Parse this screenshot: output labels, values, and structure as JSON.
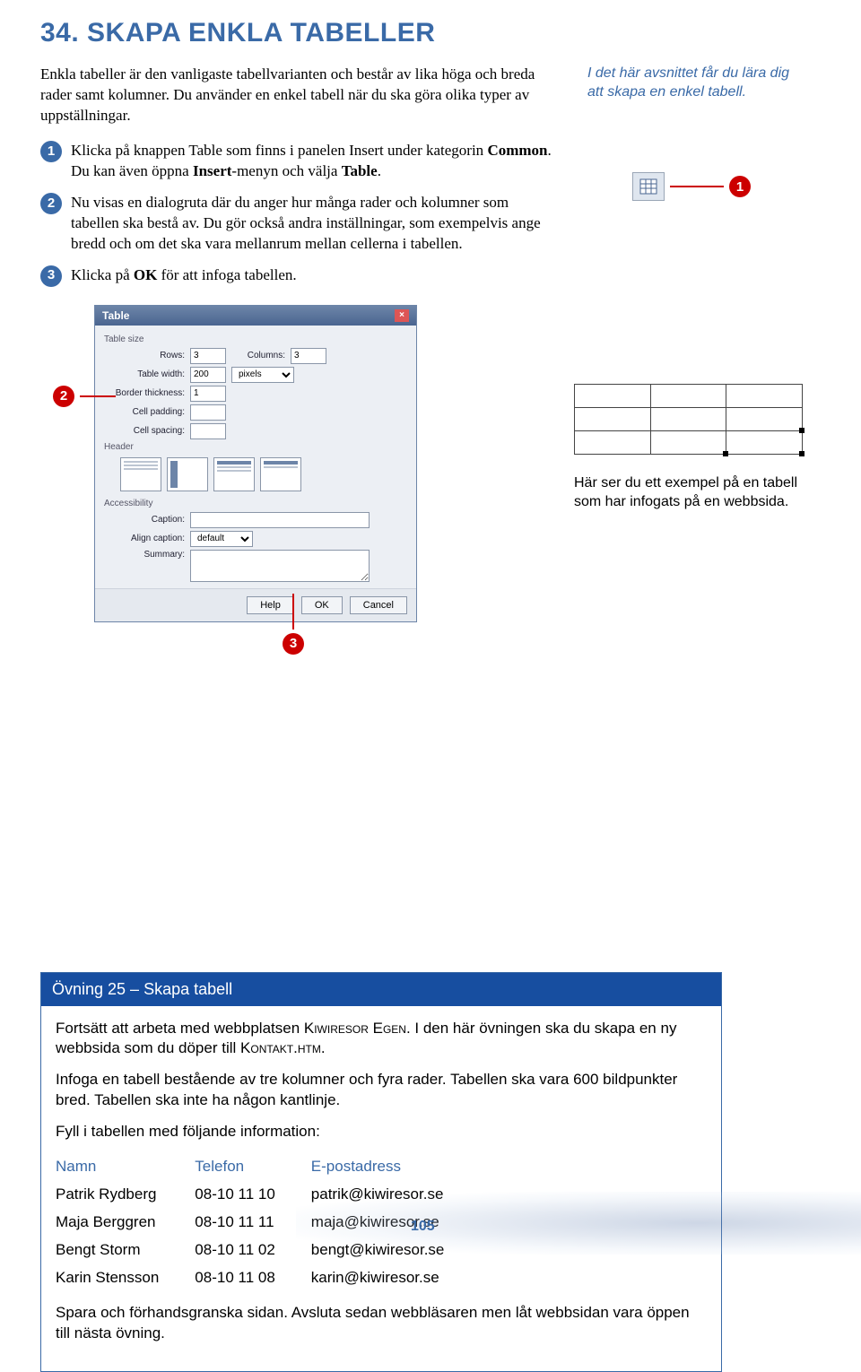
{
  "heading": "34. SKAPA ENKLA TABELLER",
  "intro": "Enkla tabeller är den vanligaste tabellvarianten och består av lika höga och breda rader samt kolumner. Du använder en enkel tabell när du ska göra olika typer av uppställningar.",
  "sidenote": "I det här avsnittet får du lära dig att skapa en enkel tabell.",
  "steps": [
    {
      "pre": "Klicka på knappen Table som finns i panelen Insert under kategorin ",
      "b1": "Common",
      "mid": ". Du kan även öppna ",
      "b2": "Insert",
      "post": "-menyn och välja ",
      "b3": "Table",
      "end": "."
    },
    {
      "text": "Nu visas en dialogruta där du anger hur många rader och kolumner som tabellen ska bestå av. Du gör också andra inställningar, som exempelvis ange bredd och om det ska vara mellanrum mellan cellerna i tabellen."
    },
    {
      "pre": "Klicka på ",
      "b1": "OK",
      "post": " för att infoga tabellen."
    }
  ],
  "dialog": {
    "title": "Table",
    "tablesize": "Table size",
    "rows_label": "Rows:",
    "rows_val": "3",
    "cols_label": "Columns:",
    "cols_val": "3",
    "width_label": "Table width:",
    "width_val": "200",
    "width_unit": "pixels",
    "border_label": "Border thickness:",
    "border_val": "1",
    "cellpad_label": "Cell padding:",
    "cellspace_label": "Cell spacing:",
    "header": "Header",
    "access": "Accessibility",
    "caption_label": "Caption:",
    "align_label": "Align caption:",
    "align_val": "default",
    "summary_label": "Summary:",
    "help": "Help",
    "ok": "OK",
    "cancel": "Cancel"
  },
  "example_caption": "Här ser du ett exempel på en tabell som har infogats på en webbsida.",
  "exercise": {
    "title": "Övning 25 – Skapa tabell",
    "p1_pre": "Fortsätt att arbeta med webbplatsen ",
    "p1_sc1": "Kiwiresor Egen",
    "p1_mid": ". I den här övningen ska du skapa en ny webbsida som du döper till ",
    "p1_sc2": "Kontakt.htm",
    "p1_end": ".",
    "p2": "Infoga en tabell bestående av tre kolumner och fyra rader. Tabellen ska vara 600 bildpunkter bred. Tabellen ska inte ha någon kantlinje.",
    "p3": "Fyll i tabellen med följande information:",
    "headers": [
      "Namn",
      "Telefon",
      "E-postadress"
    ],
    "rows": [
      [
        "Patrik Rydberg",
        "08-10 11 10",
        "patrik@kiwiresor.se"
      ],
      [
        "Maja Berggren",
        "08-10 11 11",
        "maja@kiwiresor.se"
      ],
      [
        "Bengt Storm",
        "08-10 11 02",
        "bengt@kiwiresor.se"
      ],
      [
        "Karin Stensson",
        "08-10 11 08",
        "karin@kiwiresor.se"
      ]
    ],
    "p4": "Spara och förhandsgranska sidan. Avsluta sedan webbläsaren men låt webbsidan vara öppen till nästa övning."
  },
  "page_num": "105"
}
